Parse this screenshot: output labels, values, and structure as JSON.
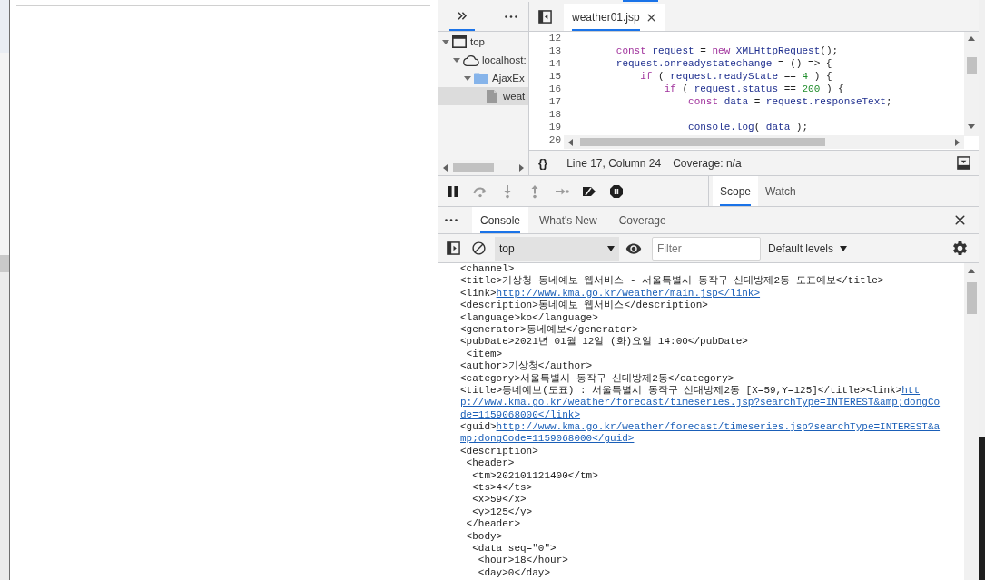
{
  "navigator": {
    "more_tabs": {
      "selected": true
    },
    "tree": [
      {
        "kind": "frame",
        "label": "top",
        "expanded": true,
        "selected": false,
        "children": [
          {
            "kind": "domain",
            "label": "localhost:",
            "expanded": true,
            "selected": false,
            "children": [
              {
                "kind": "folder",
                "label": "AjaxEx",
                "expanded": true,
                "selected": false,
                "children": [
                  {
                    "kind": "file",
                    "label": "weat",
                    "selected": true
                  }
                ]
              }
            ]
          }
        ]
      }
    ]
  },
  "editor": {
    "tabs": [
      {
        "label": "weather01.jsp",
        "selected": true
      }
    ],
    "lines": [
      {
        "number": "12"
      },
      {
        "number": "13",
        "tokens": [
          {
            "kind": "keyword",
            "text": "        const"
          },
          {
            "kind": "name",
            "text": " request "
          },
          {
            "kind": "punct",
            "text": "= "
          },
          {
            "kind": "keyword",
            "text": "new"
          },
          {
            "kind": "name",
            "text": " XMLHttpRequest"
          },
          {
            "kind": "punct",
            "text": "();"
          }
        ]
      },
      {
        "number": "14",
        "tokens": [
          {
            "kind": "name",
            "text": "        request.onreadystatechange "
          },
          {
            "kind": "punct",
            "text": "= () => {"
          }
        ]
      },
      {
        "number": "15",
        "tokens": [
          {
            "kind": "keyword",
            "text": "            if"
          },
          {
            "kind": "punct",
            "text": " ( "
          },
          {
            "kind": "name",
            "text": "request.readyState "
          },
          {
            "kind": "punct",
            "text": "== "
          },
          {
            "kind": "number",
            "text": "4"
          },
          {
            "kind": "punct",
            "text": " ) {"
          }
        ]
      },
      {
        "number": "16",
        "tokens": [
          {
            "kind": "keyword",
            "text": "                if"
          },
          {
            "kind": "punct",
            "text": " ( "
          },
          {
            "kind": "name",
            "text": "request.status "
          },
          {
            "kind": "punct",
            "text": "== "
          },
          {
            "kind": "number",
            "text": "200"
          },
          {
            "kind": "punct",
            "text": " ) {"
          }
        ]
      },
      {
        "number": "17",
        "tokens": [
          {
            "kind": "keyword",
            "text": "                    const"
          },
          {
            "kind": "name",
            "text": " data "
          },
          {
            "kind": "punct",
            "text": "= "
          },
          {
            "kind": "name",
            "text": "request.responseText"
          },
          {
            "kind": "punct",
            "text": ";"
          }
        ]
      },
      {
        "number": "18"
      },
      {
        "number": "19",
        "tokens": [
          {
            "kind": "name",
            "text": "                    console.log"
          },
          {
            "kind": "punct",
            "text": "( "
          },
          {
            "kind": "name",
            "text": "data"
          },
          {
            "kind": "punct",
            "text": " );"
          }
        ]
      },
      {
        "number": "20"
      }
    ],
    "status": {
      "pretty_print": "{}",
      "position": "Line 17, Column 24",
      "coverage": "Coverage: n/a"
    }
  },
  "debugger": {
    "controls": [
      {
        "kind": "pause",
        "disabled": false
      },
      {
        "kind": "step_over",
        "disabled": true
      },
      {
        "kind": "step_into",
        "disabled": true
      },
      {
        "kind": "step_out",
        "disabled": true
      },
      {
        "kind": "step",
        "disabled": true
      },
      {
        "kind": "deactivate_breakpoints",
        "disabled": false
      },
      {
        "kind": "pause_on_exceptions",
        "disabled": false
      }
    ],
    "sidebar_tabs": [
      {
        "label": "Scope",
        "selected": true
      },
      {
        "label": "Watch",
        "selected": false
      }
    ]
  },
  "drawer": {
    "tabs": [
      {
        "label": "Console",
        "selected": true
      },
      {
        "label": "What's New",
        "selected": false
      },
      {
        "label": "Coverage",
        "selected": false
      }
    ]
  },
  "console": {
    "toolbar": {
      "context": "top",
      "filter": {
        "placeholder": "Filter"
      },
      "levels": "Default levels"
    },
    "lines": [
      {
        "text": "<channel>"
      },
      {
        "text": "<title>기상청 동네예보 웹서비스 - 서울특별시 동작구 신대방제2동 도표예보</title>"
      },
      {
        "text": "<link>",
        "link": "http://www.kma.go.kr/weather/main.jsp</link>"
      },
      {
        "text": "<description>동네예보 웹서비스</description>"
      },
      {
        "text": "<language>ko</language>"
      },
      {
        "text": "<generator>동네예보</generator>"
      },
      {
        "text": "<pubDate>2021년 01월 12일 (화)요일 14:00</pubDate>"
      },
      {
        "text": " <item>"
      },
      {
        "text": "<author>기상청</author>"
      },
      {
        "text": "<category>서울특별시 동작구 신대방제2동</category>"
      },
      {
        "text": "<title>동네예보(도표) : 서울특별시 동작구 신대방제2동 [X=59,Y=125]</title><link>",
        "link": "htt"
      },
      {
        "link": "p://www.kma.go.kr/weather/forecast/timeseries.jsp?searchType=INTEREST&amp;dongCo"
      },
      {
        "link": "de=1159068000</link>"
      },
      {
        "text": "<guid>",
        "link": "http://www.kma.go.kr/weather/forecast/timeseries.jsp?searchType=INTEREST&a"
      },
      {
        "link": "mp;dongCode=1159068000</guid>"
      },
      {
        "text": "<description>"
      },
      {
        "text": " <header>"
      },
      {
        "text": "  <tm>202101121400</tm>"
      },
      {
        "text": "  <ts>4</ts>"
      },
      {
        "text": "  <x>59</x>"
      },
      {
        "text": "  <y>125</y>"
      },
      {
        "text": " </header>"
      },
      {
        "text": " <body>"
      },
      {
        "text": "  <data seq=\"0\">"
      },
      {
        "text": "   <hour>18</hour>"
      },
      {
        "text": "   <day>0</day>"
      }
    ]
  }
}
